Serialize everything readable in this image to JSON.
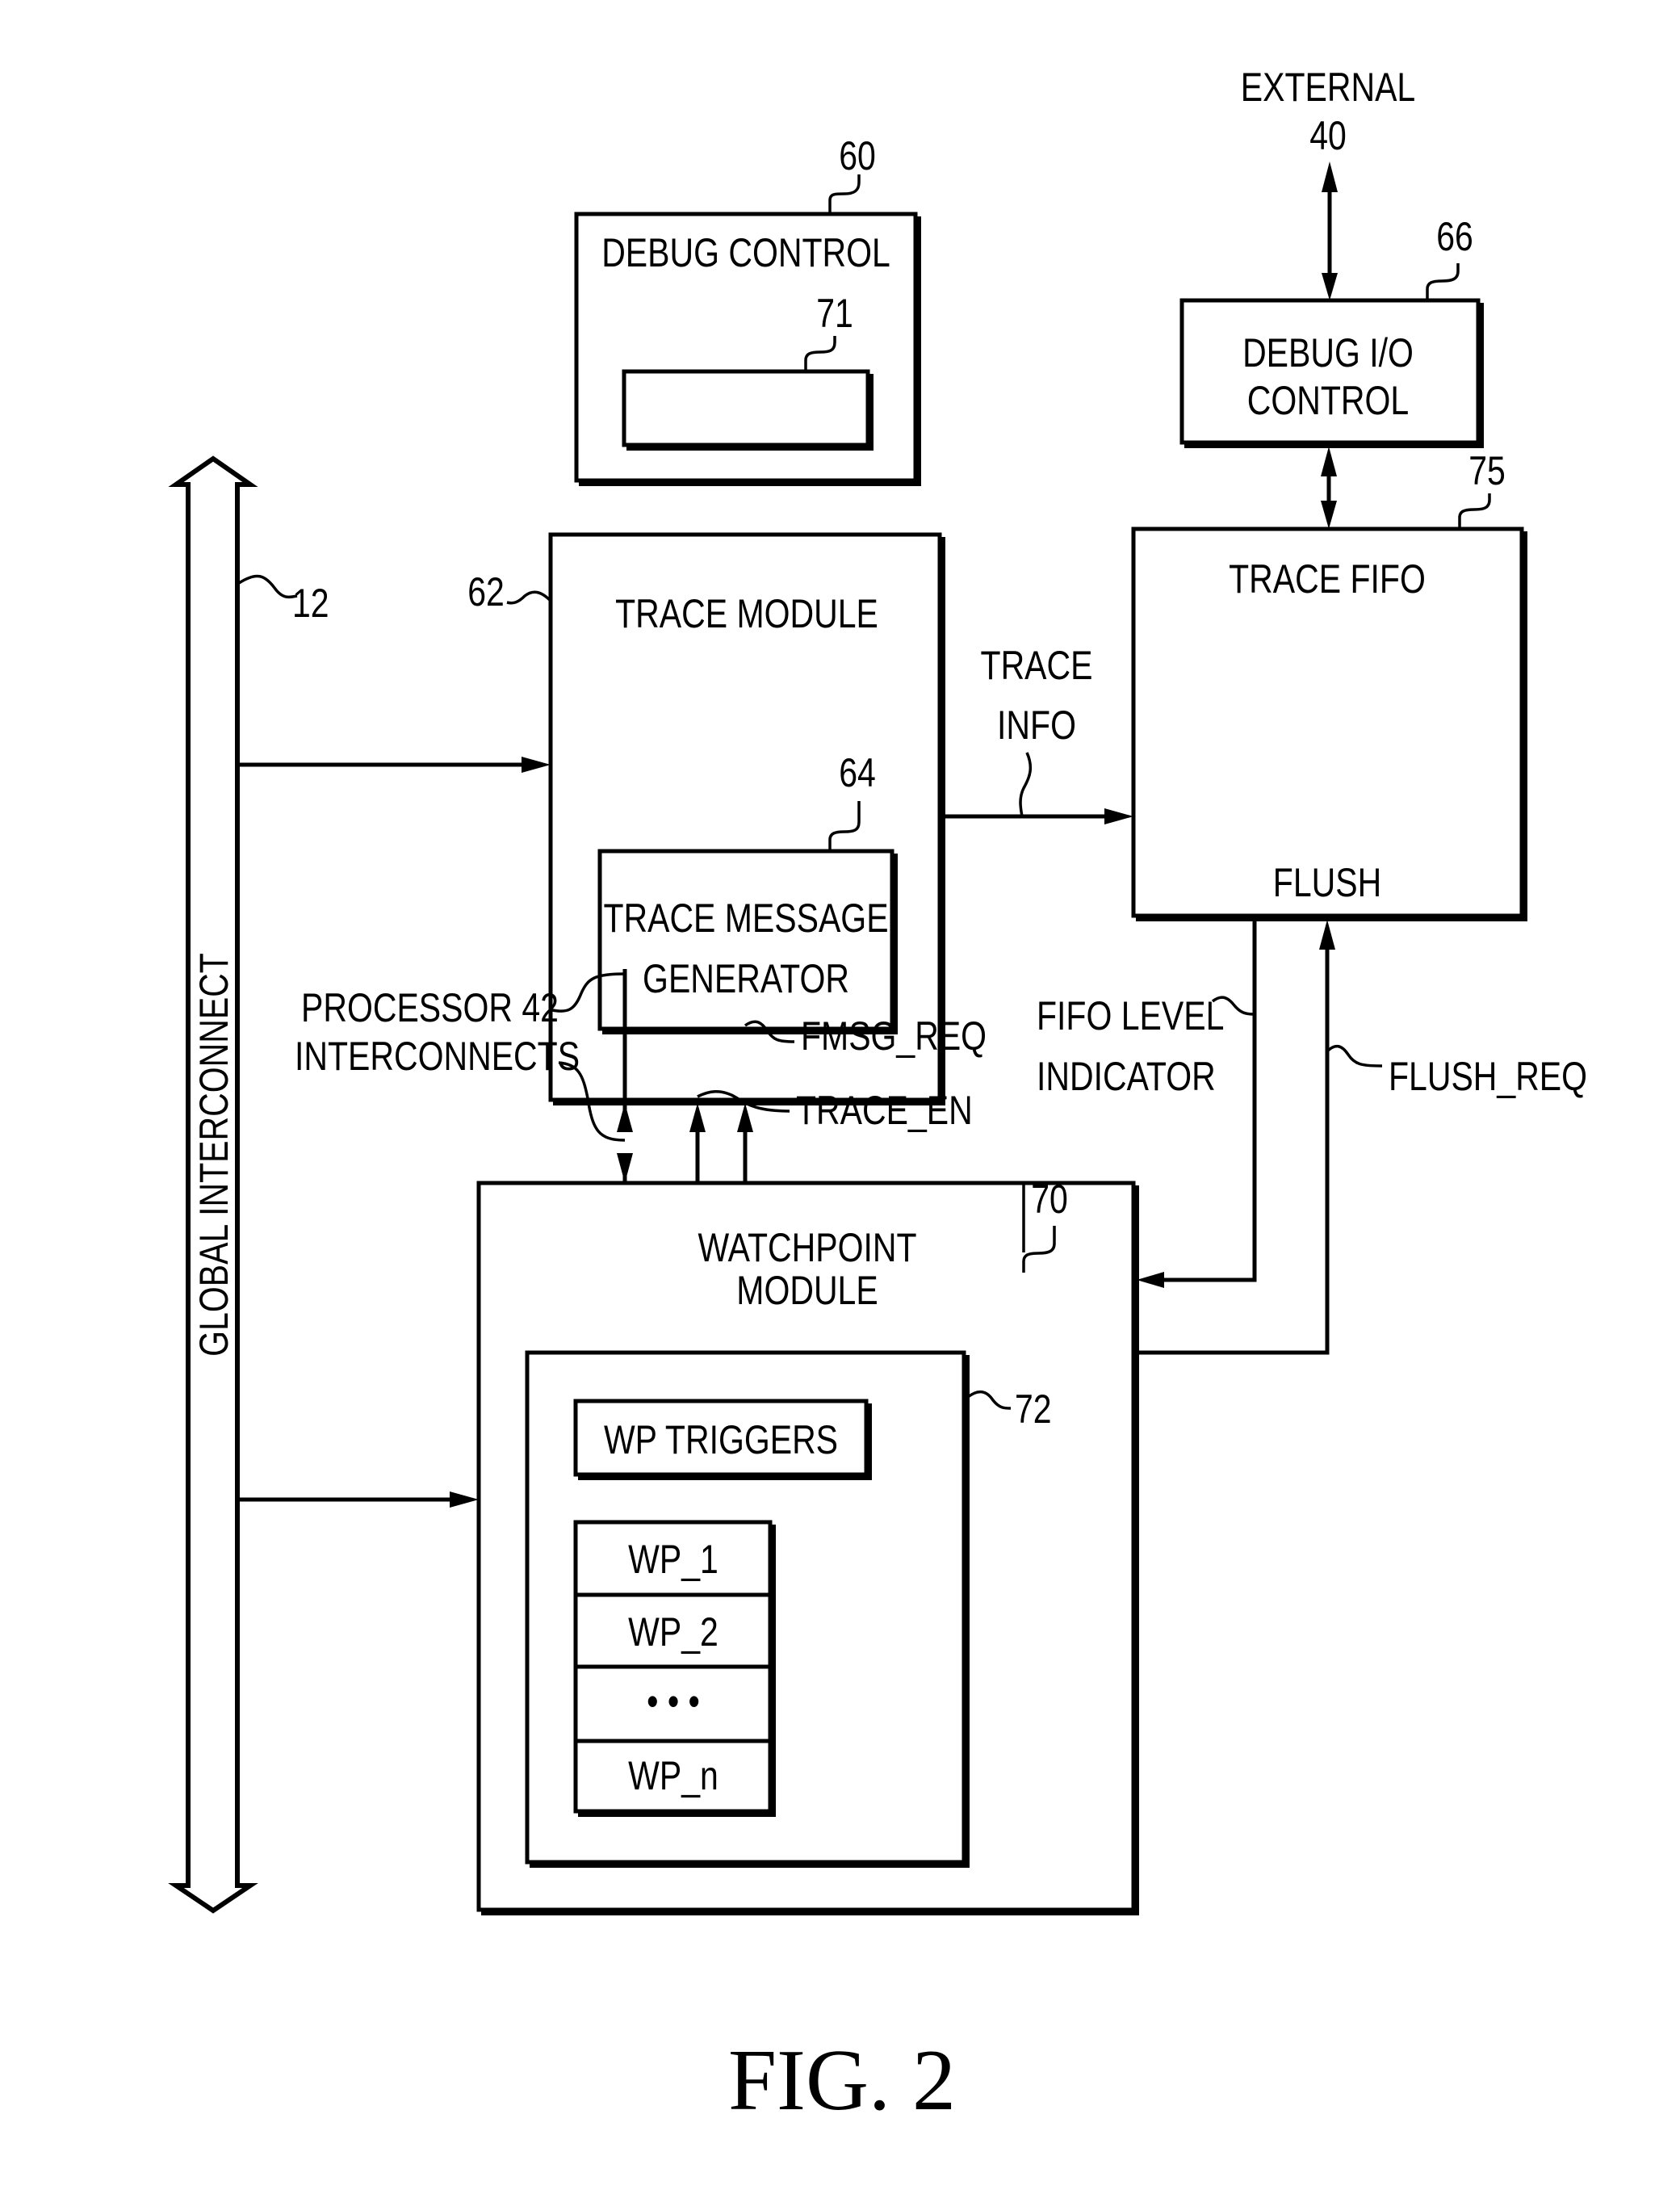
{
  "figure": {
    "caption": "FIG. 2",
    "blocks": {
      "debug_control": {
        "label": "DEBUG CONTROL",
        "ref": "60",
        "inner_ref": "71"
      },
      "debug_io": {
        "label_line1": "DEBUG I/O",
        "label_line2": "CONTROL",
        "ref": "66"
      },
      "external": {
        "label": "EXTERNAL",
        "ref": "40"
      },
      "trace_module": {
        "label": "TRACE MODULE",
        "ref": "62"
      },
      "trace_message_generator": {
        "label_line1": "TRACE MESSAGE",
        "label_line2": "GENERATOR",
        "ref": "64"
      },
      "trace_fifo": {
        "label": "TRACE FIFO",
        "flush_label": "FLUSH",
        "ref": "75"
      },
      "watchpoint_module": {
        "label_line1": "WATCHPOINT",
        "label_line2": "MODULE",
        "ref": "70"
      },
      "watchpoint_group": {
        "ref": "72"
      },
      "wp_triggers": {
        "label": "WP TRIGGERS"
      },
      "wp_list": [
        "WP_1",
        "WP_2",
        "• • •",
        "WP_n"
      ],
      "global_interconnect": {
        "label": "GLOBAL INTERCONNECT",
        "ref": "12"
      }
    },
    "signals": {
      "trace_info_line1": "TRACE",
      "trace_info_line2": "INFO",
      "processor_line1": "PROCESSOR 42",
      "processor_line2": "INTERCONNECTS",
      "fmsg_req": "FMSG_REQ",
      "trace_en": "TRACE_EN",
      "fifo_level_line1": "FIFO LEVEL",
      "fifo_level_line2": "INDICATOR",
      "flush_req": "FLUSH_REQ"
    }
  }
}
